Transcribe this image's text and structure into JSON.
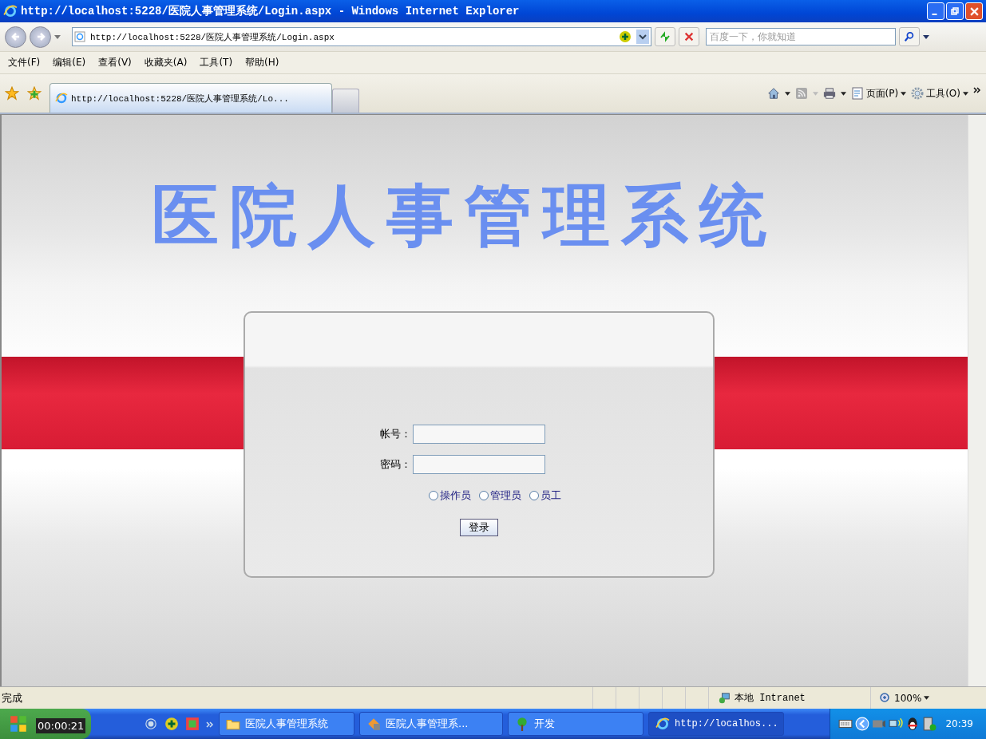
{
  "window": {
    "title": "http://localhost:5228/医院人事管理系统/Login.aspx - Windows Internet Explorer"
  },
  "address_bar": {
    "url": "http://localhost:5228/医院人事管理系统/Login.aspx"
  },
  "search": {
    "placeholder": "百度一下，你就知道"
  },
  "menu": [
    "文件(F)",
    "编辑(E)",
    "查看(V)",
    "收藏夹(A)",
    "工具(T)",
    "帮助(H)"
  ],
  "tabs": [
    {
      "label": "http://localhost:5228/医院人事管理系统/Lo...",
      "selected": true
    }
  ],
  "command_bar": [
    {
      "label": "页面(P)",
      "kind": "page"
    },
    {
      "label": "工具(O)",
      "kind": "tools"
    }
  ],
  "page": {
    "heading": "医院人事管理系统",
    "fields": [
      {
        "label": "帐号："
      },
      {
        "label": "密码："
      }
    ],
    "roles": [
      {
        "label": "操作员",
        "selected": false
      },
      {
        "label": "管理员",
        "selected": false
      },
      {
        "label": "员工",
        "selected": false
      }
    ],
    "submit": "登录"
  },
  "status_bar": {
    "text": "完成",
    "zone": "本地 Intranet",
    "zoom": "100%"
  },
  "taskbar": {
    "timer": "00:00:21",
    "items": [
      {
        "label": "医院人事管理系统",
        "kind": "folder"
      },
      {
        "label": "医院人事管理系...",
        "kind": "app"
      },
      {
        "label": "开发",
        "kind": "tree"
      },
      {
        "label": "http://localhos...",
        "kind": "ie"
      }
    ],
    "clock": "20:39"
  }
}
